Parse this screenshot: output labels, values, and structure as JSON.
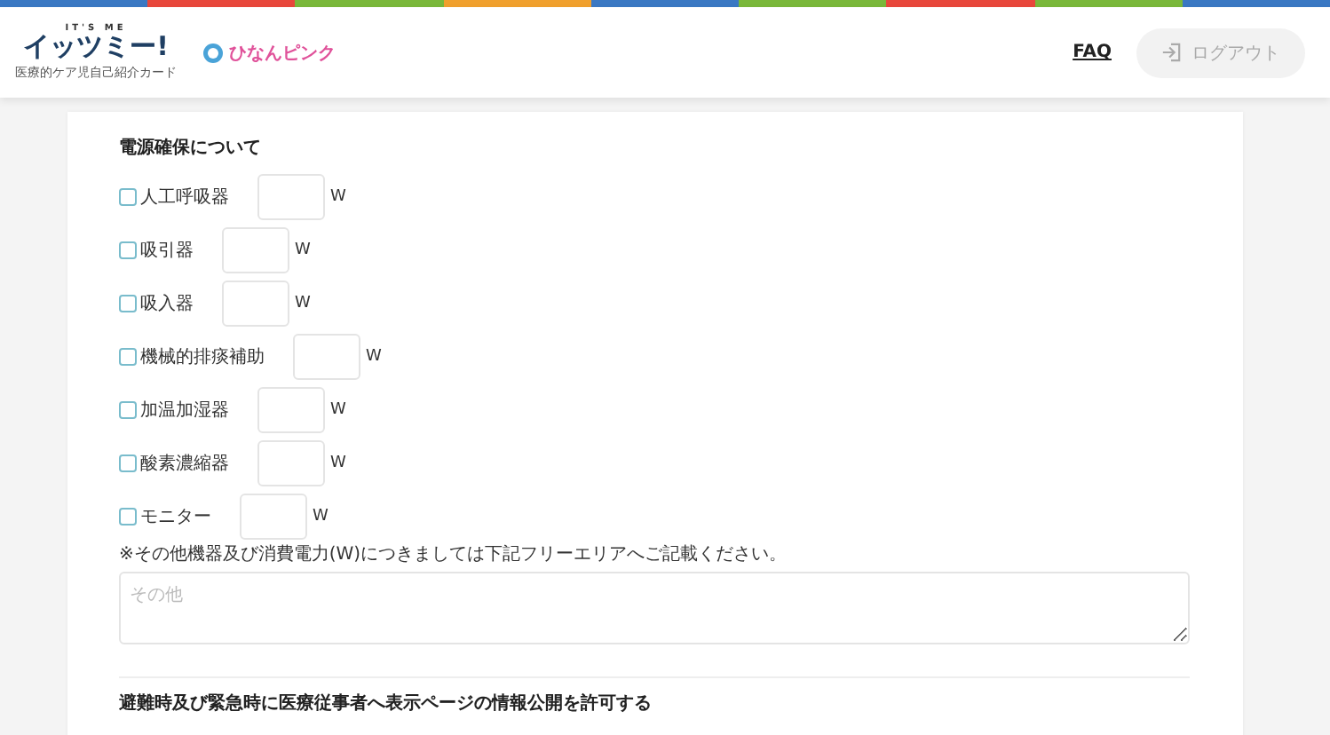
{
  "header": {
    "logo": {
      "tagline": "IT'S ME",
      "name": "イッツミー!",
      "subtitle": "医療的ケア児自己紹介カード"
    },
    "partner_logo": "ひなんピンク",
    "links": [
      {
        "label": "FAQ"
      }
    ],
    "logout_button": {
      "label": "ログアウト",
      "disabled": true
    }
  },
  "power_section": {
    "heading": "電源確保について",
    "devices": [
      {
        "label": "人工呼吸器",
        "checked": false,
        "unit": "W"
      },
      {
        "label": "吸引器",
        "checked": false,
        "unit": "W"
      },
      {
        "label": "吸入器",
        "checked": false,
        "unit": "W"
      },
      {
        "label": "機械的排痰補助",
        "checked": false,
        "unit": "W"
      },
      {
        "label": "加温加湿器",
        "checked": false,
        "unit": "W"
      },
      {
        "label": "酸素濃縮器",
        "checked": false,
        "unit": "W"
      },
      {
        "label": "モニター",
        "checked": false,
        "unit": "W"
      }
    ],
    "note": "※その他機器及び消費電力(W)につきましては下記フリーエリアへご記載ください。",
    "other_field": {
      "placeholder": "その他"
    }
  },
  "next_section": {
    "heading": "避難時及び緊急時に医療従事者へ表示ページの情報公開を許可する"
  }
}
